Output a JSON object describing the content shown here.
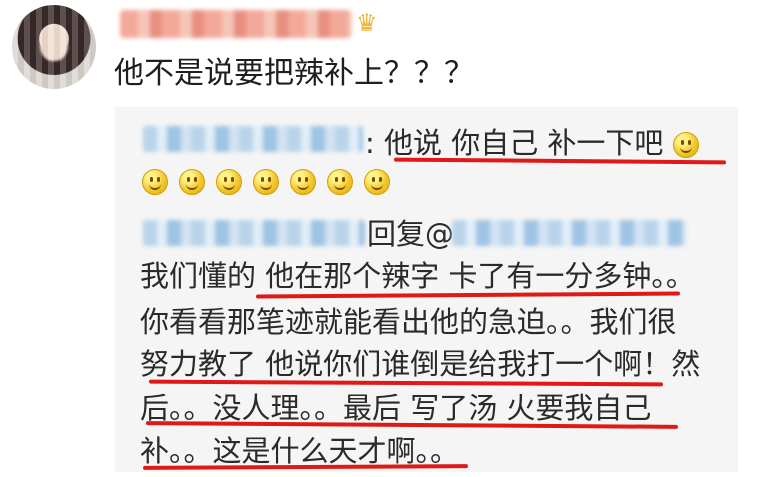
{
  "post": {
    "comment": "他不是说要把辣补上？？？"
  },
  "reply": {
    "line1_suffix": ": 他说 你自己 补一下吧",
    "reply_prefix": "回复@",
    "body_lines": [
      "我们懂的 他在那个辣字 卡了有一分多钟。。",
      "你看看那笔迹就能看出他的急迫。。我们很",
      "努力教了 他说你们谁倒是给我打一个啊！然",
      "后。。没人理。。最后 写了汤 火要我自己",
      "补。。这是什么天才啊。。"
    ]
  },
  "emoji": {
    "smiley": "smiley-emoji",
    "crown": "crown-icon"
  },
  "colors": {
    "highlight": "#e01818",
    "mention": "#2b6cb0"
  }
}
